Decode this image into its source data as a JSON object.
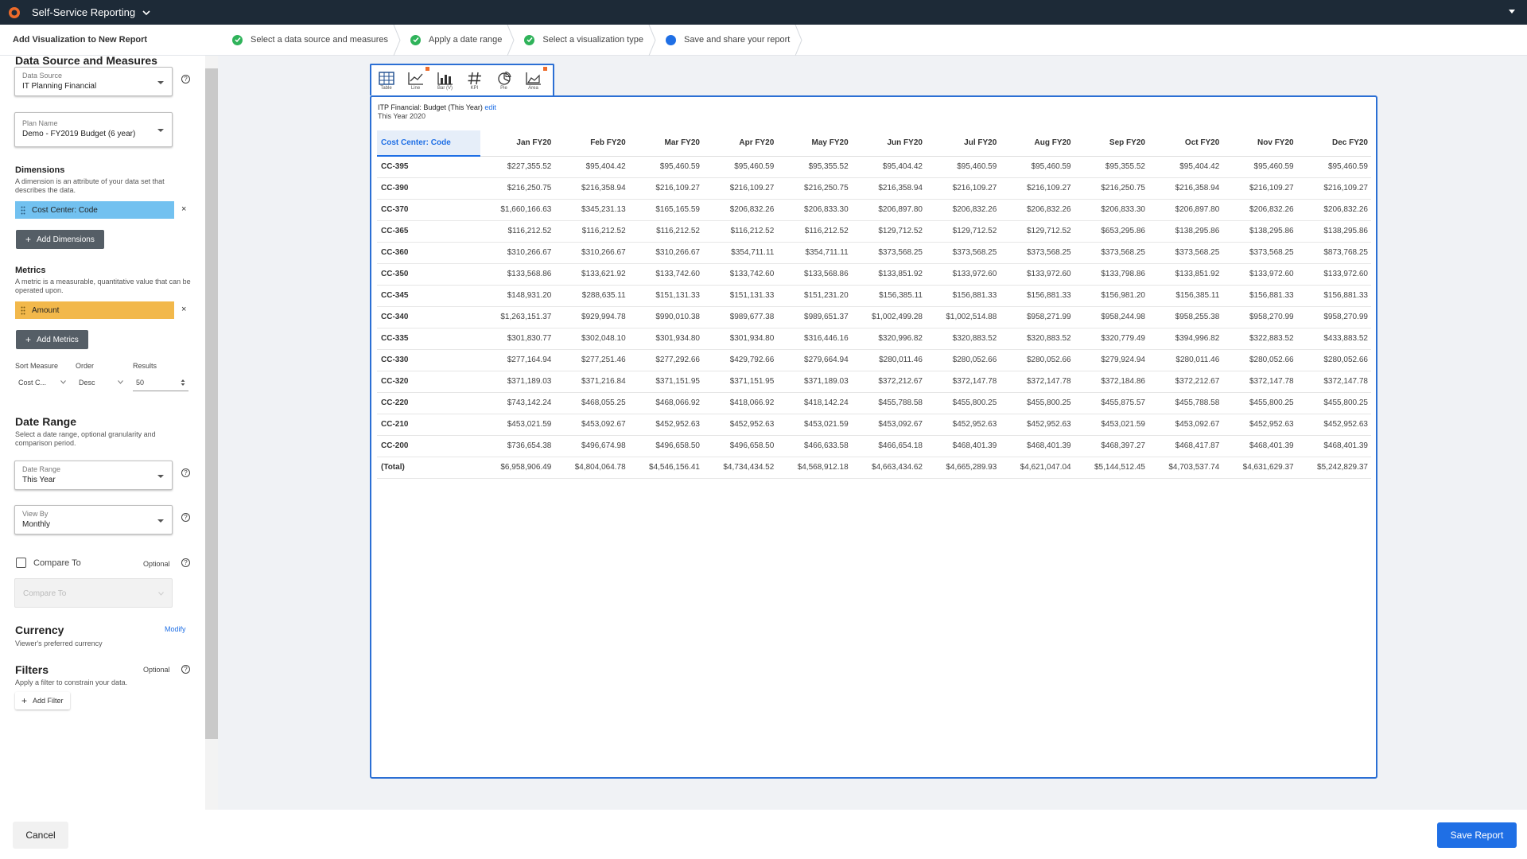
{
  "app": {
    "title": "Self-Service Reporting"
  },
  "wizard": {
    "title": "Add Visualization to New Report",
    "steps": [
      {
        "label": "Select a data source and measures",
        "status": "done"
      },
      {
        "label": "Apply a date range",
        "status": "done"
      },
      {
        "label": "Select a visualization type",
        "status": "done"
      },
      {
        "label": "Save and share your report",
        "status": "current"
      }
    ]
  },
  "sidebar": {
    "data_section": {
      "title": "Data Source and Measures",
      "data_source": {
        "label": "Data Source",
        "value": "IT Planning Financial"
      },
      "plan_name": {
        "label": "Plan Name",
        "value": "Demo - FY2019 Budget (6 year)"
      }
    },
    "dimensions": {
      "title": "Dimensions",
      "desc": "A dimension is an attribute of your data set that describes the data.",
      "item": "Cost Center: Code",
      "add_label": "Add Dimensions"
    },
    "metrics": {
      "title": "Metrics",
      "desc": "A metric is a measurable, quantitative value that can be operated upon.",
      "item": "Amount",
      "add_label": "Add Metrics"
    },
    "sort": {
      "measure_label": "Sort Measure",
      "measure_value": "Cost C...",
      "order_label": "Order",
      "order_value": "Desc",
      "results_label": "Results",
      "results_value": "50"
    },
    "date_range": {
      "title": "Date Range",
      "desc": "Select a date range, optional granularity and comparison period.",
      "range": {
        "label": "Date Range",
        "value": "This Year"
      },
      "view_by": {
        "label": "View By",
        "value": "Monthly"
      },
      "compare_label": "Compare To",
      "compare_optional": "Optional",
      "compare_placeholder": "Compare To"
    },
    "currency": {
      "title": "Currency",
      "desc": "Viewer's preferred currency",
      "modify": "Modify"
    },
    "filters": {
      "title": "Filters",
      "optional": "Optional",
      "desc": "Apply a filter to constrain your data.",
      "add_label": "Add Filter"
    }
  },
  "viz_types": [
    {
      "label": "Table",
      "icon": "table-icon",
      "flag": false
    },
    {
      "label": "Line",
      "icon": "line-chart-icon",
      "flag": true
    },
    {
      "label": "Bar (V)",
      "icon": "bar-chart-icon",
      "flag": false
    },
    {
      "label": "KPI",
      "icon": "hash-icon",
      "flag": false
    },
    {
      "label": "Pie",
      "icon": "pie-chart-icon",
      "flag": false
    },
    {
      "label": "Area",
      "icon": "area-chart-icon",
      "flag": true
    }
  ],
  "report": {
    "title": "ITP Financial: Budget (This Year)",
    "edit": "edit",
    "subtitle": "This Year 2020",
    "columns": [
      "Cost Center: Code",
      "Jan FY20",
      "Feb FY20",
      "Mar FY20",
      "Apr FY20",
      "May FY20",
      "Jun FY20",
      "Jul FY20",
      "Aug FY20",
      "Sep FY20",
      "Oct FY20",
      "Nov FY20",
      "Dec FY20"
    ],
    "rows": [
      [
        "CC-395",
        "$227,355.52",
        "$95,404.42",
        "$95,460.59",
        "$95,460.59",
        "$95,355.52",
        "$95,404.42",
        "$95,460.59",
        "$95,460.59",
        "$95,355.52",
        "$95,404.42",
        "$95,460.59",
        "$95,460.59"
      ],
      [
        "CC-390",
        "$216,250.75",
        "$216,358.94",
        "$216,109.27",
        "$216,109.27",
        "$216,250.75",
        "$216,358.94",
        "$216,109.27",
        "$216,109.27",
        "$216,250.75",
        "$216,358.94",
        "$216,109.27",
        "$216,109.27"
      ],
      [
        "CC-370",
        "$1,660,166.63",
        "$345,231.13",
        "$165,165.59",
        "$206,832.26",
        "$206,833.30",
        "$206,897.80",
        "$206,832.26",
        "$206,832.26",
        "$206,833.30",
        "$206,897.80",
        "$206,832.26",
        "$206,832.26"
      ],
      [
        "CC-365",
        "$116,212.52",
        "$116,212.52",
        "$116,212.52",
        "$116,212.52",
        "$116,212.52",
        "$129,712.52",
        "$129,712.52",
        "$129,712.52",
        "$653,295.86",
        "$138,295.86",
        "$138,295.86",
        "$138,295.86"
      ],
      [
        "CC-360",
        "$310,266.67",
        "$310,266.67",
        "$310,266.67",
        "$354,711.11",
        "$354,711.11",
        "$373,568.25",
        "$373,568.25",
        "$373,568.25",
        "$373,568.25",
        "$373,568.25",
        "$373,568.25",
        "$873,768.25"
      ],
      [
        "CC-350",
        "$133,568.86",
        "$133,621.92",
        "$133,742.60",
        "$133,742.60",
        "$133,568.86",
        "$133,851.92",
        "$133,972.60",
        "$133,972.60",
        "$133,798.86",
        "$133,851.92",
        "$133,972.60",
        "$133,972.60"
      ],
      [
        "CC-345",
        "$148,931.20",
        "$288,635.11",
        "$151,131.33",
        "$151,131.33",
        "$151,231.20",
        "$156,385.11",
        "$156,881.33",
        "$156,881.33",
        "$156,981.20",
        "$156,385.11",
        "$156,881.33",
        "$156,881.33"
      ],
      [
        "CC-340",
        "$1,263,151.37",
        "$929,994.78",
        "$990,010.38",
        "$989,677.38",
        "$989,651.37",
        "$1,002,499.28",
        "$1,002,514.88",
        "$958,271.99",
        "$958,244.98",
        "$958,255.38",
        "$958,270.99",
        "$958,270.99"
      ],
      [
        "CC-335",
        "$301,830.77",
        "$302,048.10",
        "$301,934.80",
        "$301,934.80",
        "$316,446.16",
        "$320,996.82",
        "$320,883.52",
        "$320,883.52",
        "$320,779.49",
        "$394,996.82",
        "$322,883.52",
        "$433,883.52"
      ],
      [
        "CC-330",
        "$277,164.94",
        "$277,251.46",
        "$277,292.66",
        "$429,792.66",
        "$279,664.94",
        "$280,011.46",
        "$280,052.66",
        "$280,052.66",
        "$279,924.94",
        "$280,011.46",
        "$280,052.66",
        "$280,052.66"
      ],
      [
        "CC-320",
        "$371,189.03",
        "$371,216.84",
        "$371,151.95",
        "$371,151.95",
        "$371,189.03",
        "$372,212.67",
        "$372,147.78",
        "$372,147.78",
        "$372,184.86",
        "$372,212.67",
        "$372,147.78",
        "$372,147.78"
      ],
      [
        "CC-220",
        "$743,142.24",
        "$468,055.25",
        "$468,066.92",
        "$418,066.92",
        "$418,142.24",
        "$455,788.58",
        "$455,800.25",
        "$455,800.25",
        "$455,875.57",
        "$455,788.58",
        "$455,800.25",
        "$455,800.25"
      ],
      [
        "CC-210",
        "$453,021.59",
        "$453,092.67",
        "$452,952.63",
        "$452,952.63",
        "$453,021.59",
        "$453,092.67",
        "$452,952.63",
        "$452,952.63",
        "$453,021.59",
        "$453,092.67",
        "$452,952.63",
        "$452,952.63"
      ],
      [
        "CC-200",
        "$736,654.38",
        "$496,674.98",
        "$496,658.50",
        "$496,658.50",
        "$466,633.58",
        "$466,654.18",
        "$468,401.39",
        "$468,401.39",
        "$468,397.27",
        "$468,417.87",
        "$468,401.39",
        "$468,401.39"
      ],
      [
        "(Total)",
        "$6,958,906.49",
        "$4,804,064.78",
        "$4,546,156.41",
        "$4,734,434.52",
        "$4,568,912.18",
        "$4,663,434.62",
        "$4,665,289.93",
        "$4,621,047.04",
        "$5,144,512.45",
        "$4,703,537.74",
        "$4,631,629.37",
        "$5,242,829.37"
      ]
    ]
  },
  "footer": {
    "cancel": "Cancel",
    "save": "Save Report"
  },
  "colors": {
    "primary": "#1f6fe5",
    "success": "#2fb35a",
    "dimension_pill": "#72c1f0",
    "metric_pill": "#f2b84b",
    "topbar": "#1d2a37"
  }
}
